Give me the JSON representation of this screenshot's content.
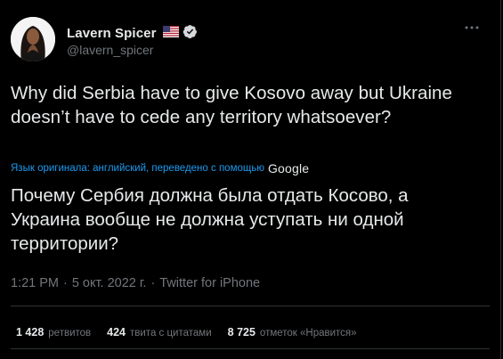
{
  "author": {
    "display_name": "Lavern Spicer",
    "handle": "@lavern_spicer",
    "flag_icon": "us-flag-icon",
    "verified_icon": "verified-badge-icon",
    "verified_color": "#d6d9db"
  },
  "more_icon": "more-horizontal-icon",
  "tweet": {
    "text": "Why did Serbia have to give Kosovo away but Ukraine doesn’t have to cede any territory whatsoever?",
    "translation_note": "Язык оригинала: английский, переведено с помощью",
    "translation_provider": "Google",
    "translated_text": "Почему Сербия должна была отдать Косово, а Украина вообще не должна уступать ни одной территории?"
  },
  "meta": {
    "time": "1:21 PM",
    "separator": "·",
    "date": "5 окт. 2022 г.",
    "source": "Twitter for iPhone"
  },
  "stats": {
    "retweets_count": "1 428",
    "retweets_label": "ретвитов",
    "quotes_count": "424",
    "quotes_label": "твита с цитатами",
    "likes_count": "8 725",
    "likes_label": "отметок «Нравится»"
  },
  "colors": {
    "background": "#000000",
    "text": "#e7e9ea",
    "secondary": "#71767b",
    "link": "#1d9bf0",
    "divider": "#2f3336"
  }
}
